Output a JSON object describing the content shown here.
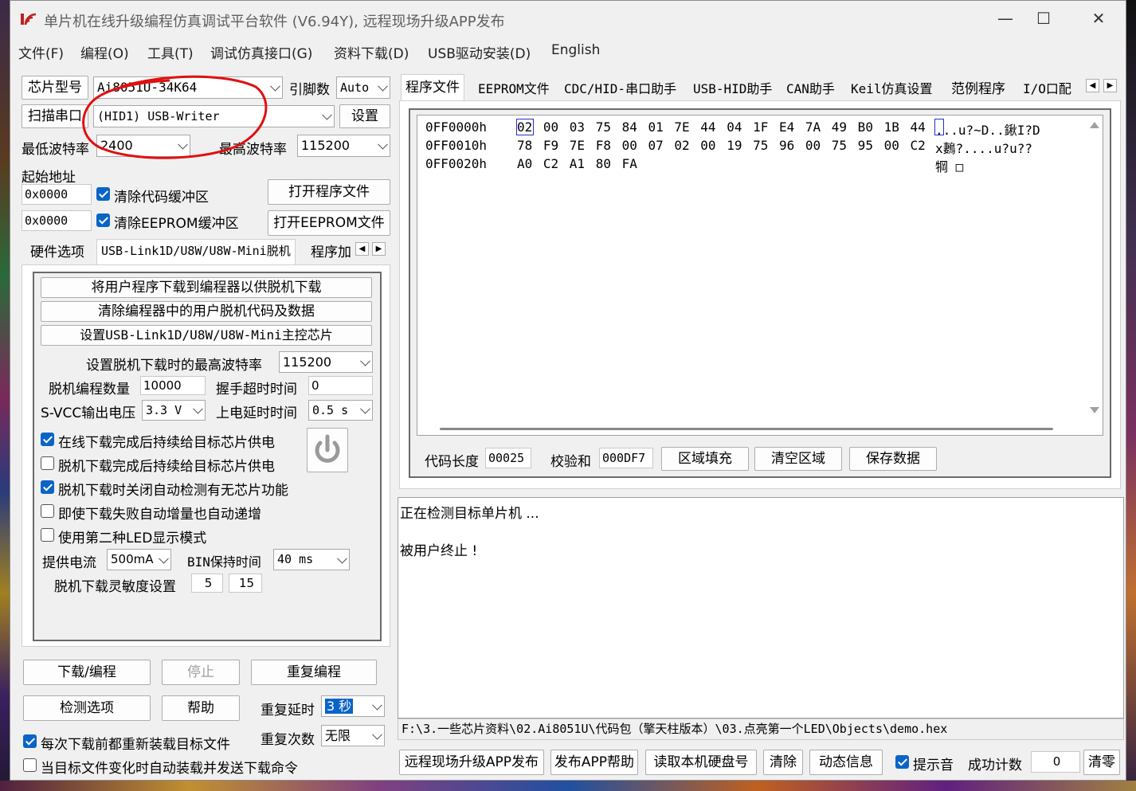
{
  "window": {
    "title": "单片机在线升级编程仿真调试平台软件 (V6.94Y), 远程现场升级APP发布"
  },
  "menu": [
    "文件(F)",
    "编程(O)",
    "工具(T)",
    "调试仿真接口(G)",
    "资料下载(D)",
    "USB驱动安装(D)",
    "English"
  ],
  "left": {
    "chip_label": "芯片型号",
    "chip_value": "Ai8051U-34K64",
    "pins_label": "引脚数",
    "pins_value": "Auto",
    "scan_label": "扫描串口",
    "port_value": "(HID1) USB-Writer",
    "settings_label": "设置",
    "min_baud_label": "最低波特率",
    "min_baud_value": "2400",
    "max_baud_label": "最高波特率",
    "max_baud_value": "115200",
    "start_addr_label": "起始地址",
    "addr1": "0x0000",
    "clear_code_label": "清除代码缓冲区",
    "open_prog_label": "打开程序文件",
    "addr2": "0x0000",
    "clear_eeprom_label": "清除EEPROM缓冲区",
    "open_eeprom_label": "打开EEPROM文件",
    "tabs": [
      "硬件选项",
      "USB-Link1D/U8W/U8W-Mini脱机",
      "程序加"
    ],
    "offline": {
      "btn1": "将用户程序下载到编程器以供脱机下载",
      "btn2": "清除编程器中的用户脱机代码及数据",
      "btn3": "设置USB-Link1D/U8W/U8W-Mini主控芯片",
      "max_baud_label": "设置脱机下载时的最高波特率",
      "max_baud_value": "115200",
      "count_label": "脱机编程数量",
      "count_value": "10000",
      "handshake_label": "握手超时时间",
      "handshake_value": "0",
      "svcc_label": "S-VCC输出电压",
      "svcc_value": "3.3 V",
      "power_delay_label": "上电延时时间",
      "power_delay_value": "0.5 s",
      "opt1": "在线下载完成后持续给目标芯片供电",
      "opt2": "脱机下载完成后持续给目标芯片供电",
      "opt3": "脱机下载时关闭自动检测有无芯片功能",
      "opt4": "即使下载失败自动增量也自动递增",
      "opt5": "使用第二种LED显示模式",
      "current_label": "提供电流",
      "current_value": "500mA",
      "bin_hold_label": "BIN保持时间",
      "bin_hold_value": "40 ms",
      "sens_label": "脱机下载灵敏度设置",
      "sens1": "5",
      "sens2": "15"
    },
    "download_label": "下载/编程",
    "stop_label": "停止",
    "reprogram_label": "重复编程",
    "detect_label": "检测选项",
    "help_label": "帮助",
    "repeat_delay_label": "重复延时",
    "repeat_delay_value": "3 秒",
    "repeat_count_label": "重复次数",
    "repeat_count_value": "无限",
    "reload_label": "每次下载前都重新装载目标文件",
    "auto_reload_label": "当目标文件变化时自动装载并发送下载命令"
  },
  "right": {
    "tabs": [
      "程序文件",
      "EEPROM文件",
      "CDC/HID-串口助手",
      "USB-HID助手",
      "CAN助手",
      "Keil仿真设置",
      "范例程序",
      "I/O口配"
    ],
    "hex_rows": [
      {
        "addr": "0FF0000h",
        "bytes": "02 00 03 75 84 01 7E 44 04 1F E4 7A 49 B0 1B 44",
        "ascii": "...u?~D..鍬I?D"
      },
      {
        "addr": "0FF0010h",
        "bytes": "78 F9 7E F8 00 07 02 00 19 75 96 00 75 95 00 C2",
        "ascii": "x鶈?....u?u??"
      },
      {
        "addr": "0FF0020h",
        "bytes": "A0 C2 A1 80 FA",
        "ascii": "犅 □"
      }
    ],
    "code_len_label": "代码长度",
    "code_len_value": "00025",
    "checksum_label": "校验和",
    "checksum_value": "000DF7",
    "fill_label": "区域填充",
    "clear_area_label": "清空区域",
    "save_label": "保存数据",
    "log": [
      "正在检测目标单片机 ...",
      "被用户终止 !"
    ],
    "path": "F:\\3.一些芯片资料\\02.Ai8051U\\代码包（擎天柱版本）\\03.点亮第一个LED\\Objects\\demo.hex",
    "bottom": {
      "publish_label": "远程现场升级APP发布",
      "publish_help_label": "发布APP帮助",
      "read_hd_label": "读取本机硬盘号",
      "clear_label": "清除",
      "dynamic_label": "动态信息",
      "beep_label": "提示音",
      "success_label": "成功计数",
      "success_value": "0",
      "zero_label": "清零"
    }
  },
  "colors": {
    "accent": "#0a64c8",
    "annotation": "#e01010"
  }
}
